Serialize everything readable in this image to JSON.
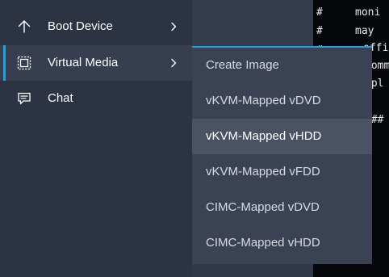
{
  "menu": {
    "items": [
      {
        "label": "Boot Device",
        "icon": "arrow-up-icon",
        "has_submenu": true
      },
      {
        "label": "Virtual Media",
        "icon": "virtual-media-icon",
        "has_submenu": true,
        "selected": true
      },
      {
        "label": "Chat",
        "icon": "chat-bubble-icon",
        "has_submenu": false
      }
    ]
  },
  "submenu": {
    "items": [
      {
        "label": "Create Image"
      },
      {
        "label": "vKVM-Mapped vDVD"
      },
      {
        "label": "vKVM-Mapped vHDD",
        "highlighted": true
      },
      {
        "label": "vKVM-Mapped vFDD"
      },
      {
        "label": "CIMC-Mapped vDVD"
      },
      {
        "label": "CIMC-Mapped vHDD"
      }
    ]
  },
  "terminal": {
    "lines": [
      "moni",
      "may ",
      "offi",
      "comm",
      "mpl",
      "###"
    ],
    "hash_lines": [
      "#",
      "#",
      "#"
    ]
  },
  "colors": {
    "accent": "#1fa3e0",
    "menu_bg": "#2c3342",
    "submenu_bg": "#3a4253",
    "highlight_bg": "#4a5264",
    "terminal_bg": "#05070b"
  }
}
